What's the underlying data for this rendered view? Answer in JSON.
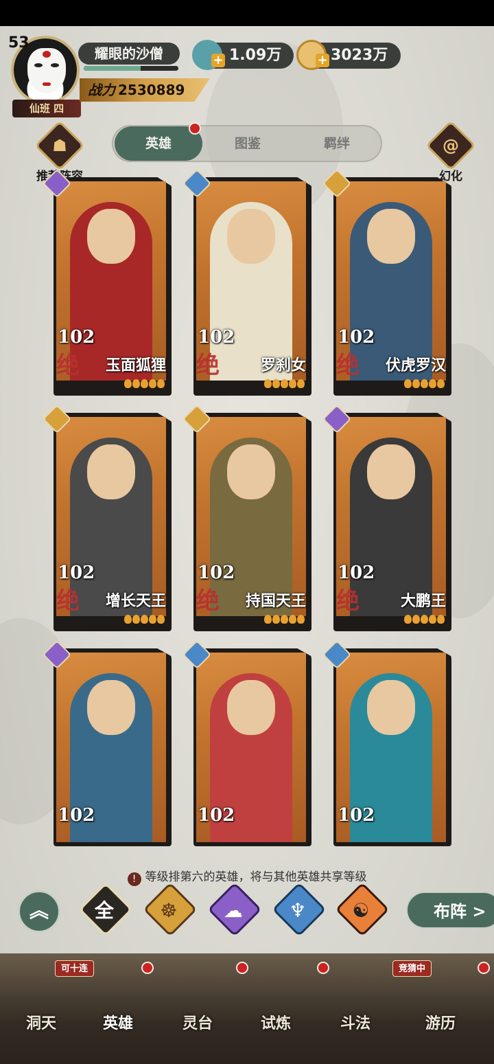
{
  "player": {
    "level": "53",
    "name": "耀眼的沙僧",
    "rank": "仙班 四",
    "power_label": "战力",
    "power_value": "2530889",
    "exp_fraction": 0.6
  },
  "currencies": [
    {
      "value": "1.09万",
      "icon": "jade-icon"
    },
    {
      "value": "3023万",
      "icon": "coin-icon"
    }
  ],
  "side_buttons": {
    "left": "推荐阵容",
    "right": "幻化"
  },
  "tabs": [
    {
      "label": "英雄",
      "active": true
    },
    {
      "label": "图鉴",
      "active": false
    },
    {
      "label": "羁绊",
      "active": false
    }
  ],
  "cards": [
    {
      "name": "玉面狐狸",
      "level": "102",
      "grade": "绝",
      "faction": "purple",
      "stars": 5
    },
    {
      "name": "罗刹女",
      "level": "102",
      "grade": "绝",
      "faction": "blue",
      "stars": 5
    },
    {
      "name": "伏虎罗汉",
      "level": "102",
      "grade": "绝",
      "faction": "gold",
      "stars": 5
    },
    {
      "name": "增长天王",
      "level": "102",
      "grade": "绝",
      "faction": "gold",
      "stars": 5
    },
    {
      "name": "持国天王",
      "level": "102",
      "grade": "绝",
      "faction": "gold",
      "stars": 5
    },
    {
      "name": "大鹏王",
      "level": "102",
      "grade": "绝",
      "faction": "purple",
      "stars": 5
    },
    {
      "name": "",
      "level": "102",
      "grade": "",
      "faction": "purple",
      "stars": 0
    },
    {
      "name": "",
      "level": "102",
      "grade": "",
      "faction": "blue",
      "stars": 0
    },
    {
      "name": "",
      "level": "102",
      "grade": "",
      "faction": "blue",
      "stars": 0
    }
  ],
  "notice": "等级排第六的英雄，将与其他英雄共享等级",
  "filters": {
    "all": "全",
    "deploy": "布阵 >"
  },
  "nav": [
    {
      "label": "洞天",
      "badge": ""
    },
    {
      "label": "英雄",
      "badge": "可十连"
    },
    {
      "label": "灵台",
      "badge": ""
    },
    {
      "label": "试炼",
      "badge": ""
    },
    {
      "label": "斗法",
      "badge": "竞猜中"
    },
    {
      "label": "游历",
      "badge": ""
    }
  ],
  "colors": {
    "accent_green": "#4a6a5e",
    "gold": "#d3a04a",
    "red_dot": "#cc2222"
  }
}
